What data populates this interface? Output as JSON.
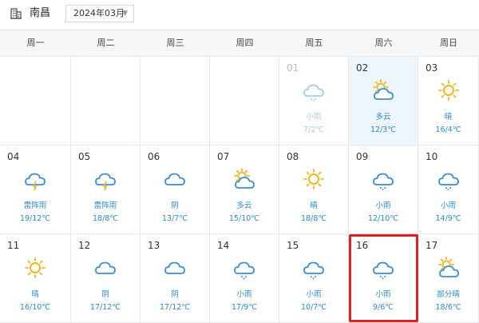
{
  "header": {
    "city_icon": "building-icon",
    "city": "南昌",
    "month": "2024年03月",
    "dropdown_icon": "chevron-down-icon"
  },
  "weekdays": [
    "周一",
    "周二",
    "周三",
    "周四",
    "周五",
    "周六",
    "周日"
  ],
  "colors": {
    "accent": "#2a8ad6",
    "highlight": "#e02020",
    "sun": "#f5b51b",
    "cloud": "#3a8fd9",
    "today_bg": "#edf5fd"
  },
  "days": [
    {
      "day": "01",
      "desc": "小雨",
      "temp": "7/2℃",
      "icon": "light-rain-icon",
      "state": "past"
    },
    {
      "day": "02",
      "desc": "多云",
      "temp": "12/3℃",
      "icon": "partly-cloudy-icon",
      "state": "today"
    },
    {
      "day": "03",
      "desc": "晴",
      "temp": "16/4℃",
      "icon": "sunny-icon"
    },
    {
      "day": "04",
      "desc": "雷阵雨",
      "temp": "19/12℃",
      "icon": "thunderstorm-icon"
    },
    {
      "day": "05",
      "desc": "雷阵雨",
      "temp": "18/8℃",
      "icon": "thunderstorm-icon"
    },
    {
      "day": "06",
      "desc": "阴",
      "temp": "13/7℃",
      "icon": "overcast-icon"
    },
    {
      "day": "07",
      "desc": "多云",
      "temp": "15/10℃",
      "icon": "partly-cloudy-icon"
    },
    {
      "day": "08",
      "desc": "晴",
      "temp": "18/8℃",
      "icon": "sunny-icon"
    },
    {
      "day": "09",
      "desc": "小雨",
      "temp": "12/10℃",
      "icon": "light-rain-icon"
    },
    {
      "day": "10",
      "desc": "小雨",
      "temp": "14/9℃",
      "icon": "light-rain-icon"
    },
    {
      "day": "11",
      "desc": "晴",
      "temp": "16/10℃",
      "icon": "sunny-icon"
    },
    {
      "day": "12",
      "desc": "阴",
      "temp": "17/12℃",
      "icon": "overcast-icon"
    },
    {
      "day": "13",
      "desc": "阴",
      "temp": "17/12℃",
      "icon": "overcast-icon"
    },
    {
      "day": "14",
      "desc": "小雨",
      "temp": "17/9℃",
      "icon": "light-rain-icon"
    },
    {
      "day": "15",
      "desc": "小雨",
      "temp": "10/7℃",
      "icon": "light-rain-icon"
    },
    {
      "day": "16",
      "desc": "小雨",
      "temp": "9/6℃",
      "icon": "light-rain-icon",
      "state": "selected"
    },
    {
      "day": "17",
      "desc": "部分晴",
      "temp": "18/6℃",
      "icon": "partly-sunny-icon"
    }
  ]
}
